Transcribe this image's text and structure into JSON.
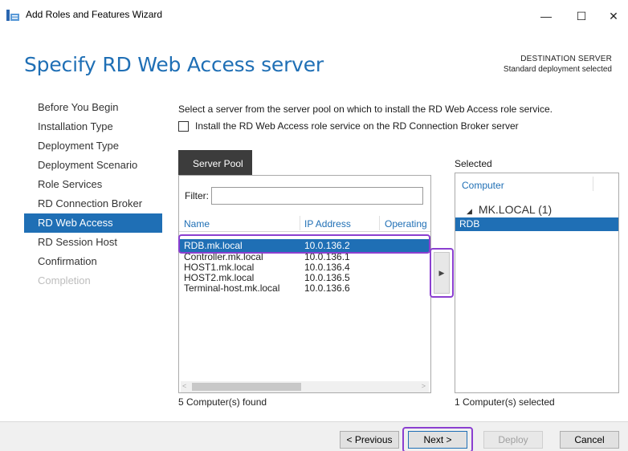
{
  "window": {
    "title": "Add Roles and Features Wizard",
    "min_icon": "—",
    "max_icon": "☐",
    "close_icon": "✕"
  },
  "header": {
    "page_title": "Specify RD Web Access server",
    "destination_label": "DESTINATION SERVER",
    "destination_value": "Standard deployment selected"
  },
  "nav": {
    "items": [
      {
        "label": "Before You Begin",
        "state": "normal"
      },
      {
        "label": "Installation Type",
        "state": "normal"
      },
      {
        "label": "Deployment Type",
        "state": "normal"
      },
      {
        "label": "Deployment Scenario",
        "state": "normal"
      },
      {
        "label": "Role Services",
        "state": "normal"
      },
      {
        "label": "RD Connection Broker",
        "state": "normal"
      },
      {
        "label": "RD Web Access",
        "state": "active"
      },
      {
        "label": "RD Session Host",
        "state": "normal"
      },
      {
        "label": "Confirmation",
        "state": "normal"
      },
      {
        "label": "Completion",
        "state": "disabled"
      }
    ]
  },
  "main": {
    "instructions": "Select a server from the server pool on which to install the RD Web Access role service.",
    "checkbox_label": "Install the RD Web Access role service on the RD Connection Broker server",
    "checkbox_checked": false,
    "pool_tab_label": "Server Pool",
    "filter_label": "Filter:",
    "filter_value": "",
    "columns": [
      "Name",
      "IP Address",
      "Operating"
    ],
    "rows": [
      {
        "name": "RDB.mk.local",
        "ip": "10.0.136.2",
        "selected": true
      },
      {
        "name": "Controller.mk.local",
        "ip": "10.0.136.1",
        "selected": false
      },
      {
        "name": "HOST1.mk.local",
        "ip": "10.0.136.4",
        "selected": false
      },
      {
        "name": "HOST2.mk.local",
        "ip": "10.0.136.5",
        "selected": false
      },
      {
        "name": "Terminal-host.mk.local",
        "ip": "10.0.136.6",
        "selected": false
      }
    ],
    "pool_count": "5 Computer(s) found",
    "move_button_glyph": "▶",
    "selected_label": "Selected",
    "selected_column": "Computer",
    "selected_group": "MK.LOCAL (1)",
    "selected_items": [
      "RDB"
    ],
    "selected_count": "1 Computer(s) selected"
  },
  "footer": {
    "previous_label": "< Previous",
    "next_label": "Next >",
    "deploy_label": "Deploy",
    "cancel_label": "Cancel"
  },
  "colors": {
    "accent": "#1f6fb5",
    "highlight_outline": "#8b3fd0",
    "tab_dark": "#3c3c3c"
  }
}
